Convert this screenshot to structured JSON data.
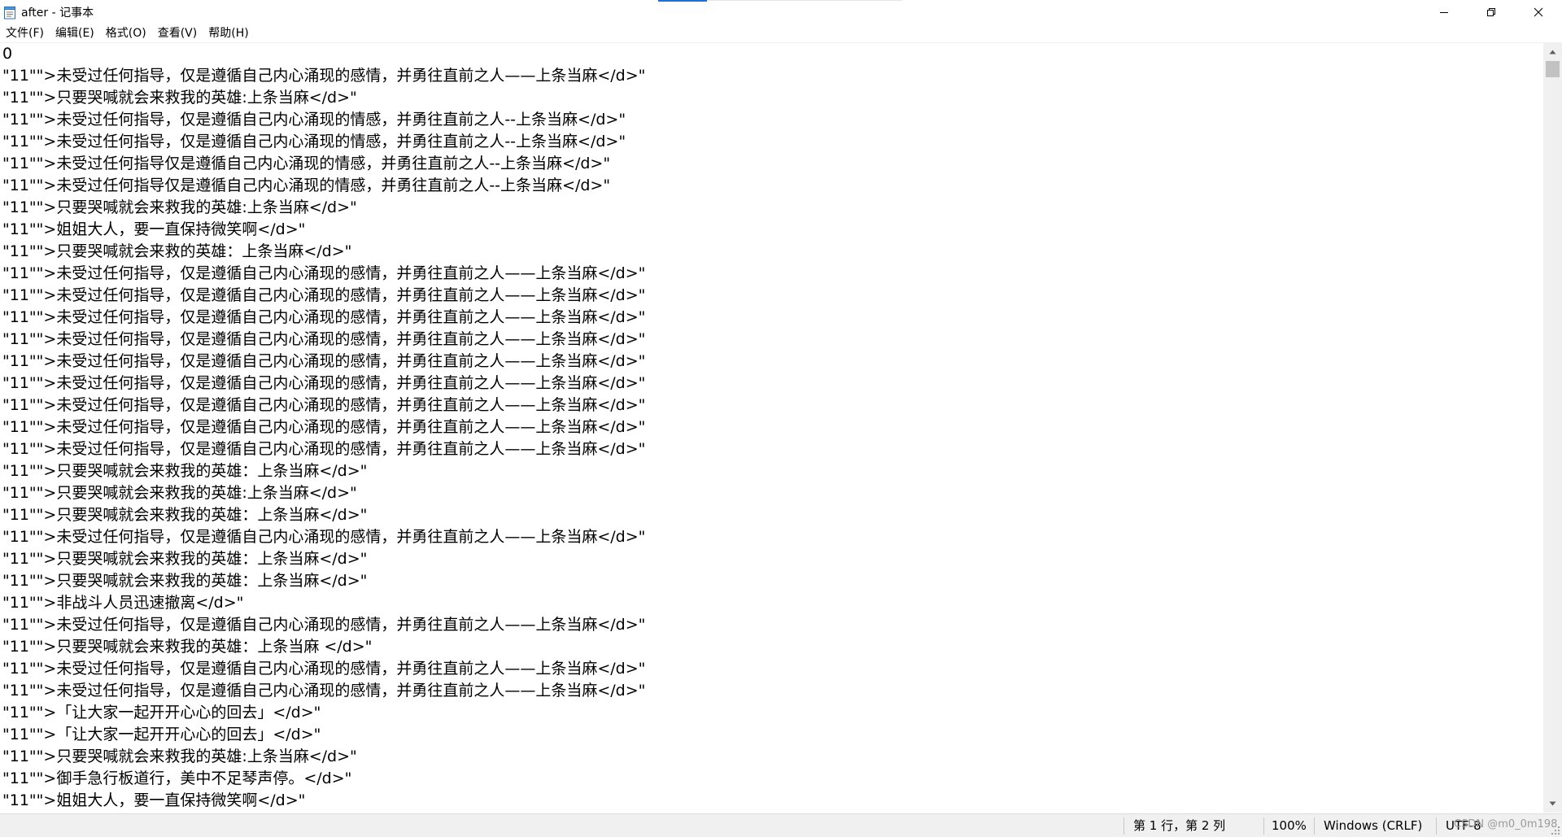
{
  "window": {
    "title": "after - 记事本"
  },
  "menu": [
    {
      "label": "文件(F)"
    },
    {
      "label": "编辑(E)"
    },
    {
      "label": "格式(O)"
    },
    {
      "label": "查看(V)"
    },
    {
      "label": "帮助(H)"
    }
  ],
  "editor": {
    "lines": [
      "0",
      "\"11\"\">未受过任何指导，仅是遵循自己内心涌现的感情，并勇往直前之人——上条当麻</d>\"",
      "\"11\"\">只要哭喊就会来救我的英雄:上条当麻</d>\"",
      "\"11\"\">未受过任何指导，仅是遵循自己内心涌现的情感，并勇往直前之人--上条当麻</d>\"",
      "\"11\"\">未受过任何指导，仅是遵循自己内心涌现的情感，并勇往直前之人--上条当麻</d>\"",
      "\"11\"\">未受过任何指导仅是遵循自己内心涌现的情感，并勇往直前之人--上条当麻</d>\"",
      "\"11\"\">未受过任何指导仅是遵循自己内心涌现的情感，并勇往直前之人--上条当麻</d>\"",
      "\"11\"\">只要哭喊就会来救我的英雄:上条当麻</d>\"",
      "\"11\"\">姐姐大人，要一直保持微笑啊</d>\"",
      "\"11\"\">只要哭喊就会来救的英雄：上条当麻</d>\"",
      "\"11\"\">未受过任何指导，仅是遵循自己内心涌现的感情，并勇往直前之人——上条当麻</d>\"",
      "\"11\"\">未受过任何指导，仅是遵循自己内心涌现的感情，并勇往直前之人——上条当麻</d>\"",
      "\"11\"\">未受过任何指导，仅是遵循自己内心涌现的感情，并勇往直前之人——上条当麻</d>\"",
      "\"11\"\">未受过任何指导，仅是遵循自己内心涌现的感情，并勇往直前之人——上条当麻</d>\"",
      "\"11\"\">未受过任何指导，仅是遵循自己内心涌现的感情，并勇往直前之人——上条当麻</d>\"",
      "\"11\"\">未受过任何指导，仅是遵循自己内心涌现的感情，并勇往直前之人——上条当麻</d>\"",
      "\"11\"\">未受过任何指导，仅是遵循自己内心涌现的感情，并勇往直前之人——上条当麻</d>\"",
      "\"11\"\">未受过任何指导，仅是遵循自己内心涌现的感情，并勇往直前之人——上条当麻</d>\"",
      "\"11\"\">未受过任何指导，仅是遵循自己内心涌现的感情，并勇往直前之人——上条当麻</d>\"",
      "\"11\"\">只要哭喊就会来救我的英雄：上条当麻</d>\"",
      "\"11\"\">只要哭喊就会来救我的英雄:上条当麻</d>\"",
      "\"11\"\">只要哭喊就会来救我的英雄：上条当麻</d>\"",
      "\"11\"\">未受过任何指导，仅是遵循自己内心涌现的感情，并勇往直前之人——上条当麻</d>\"",
      "\"11\"\">只要哭喊就会来救我的英雄：上条当麻</d>\"",
      "\"11\"\">只要哭喊就会来救我的英雄：上条当麻</d>\"",
      "\"11\"\">非战斗人员迅速撤离</d>\"",
      "\"11\"\">未受过任何指导，仅是遵循自己内心涌现的感情，并勇往直前之人——上条当麻</d>\"",
      "\"11\"\">只要哭喊就会来救我的英雄：上条当麻 </d>\"",
      "\"11\"\">未受过任何指导，仅是遵循自己内心涌现的感情，并勇往直前之人——上条当麻</d>\"",
      "\"11\"\">未受过任何指导，仅是遵循自己内心涌现的感情，并勇往直前之人——上条当麻</d>\"",
      "\"11\"\">「让大家一起开开心心的回去」</d>\"",
      "\"11\"\">「让大家一起开开心心的回去」</d>\"",
      "\"11\"\">只要哭喊就会来救我的英雄:上条当麻</d>\"",
      "\"11\"\">御手急行板道行，美中不足琴声停。</d>\"",
      "\"11\"\">姐姐大人，要一直保持微笑啊</d>\""
    ]
  },
  "statusbar": {
    "position": "第 1 行，第 2 列",
    "zoom": "100%",
    "line_ending": "Windows (CRLF)",
    "encoding": "UTF-8",
    "watermark": "CSDN @m0_0m198"
  }
}
